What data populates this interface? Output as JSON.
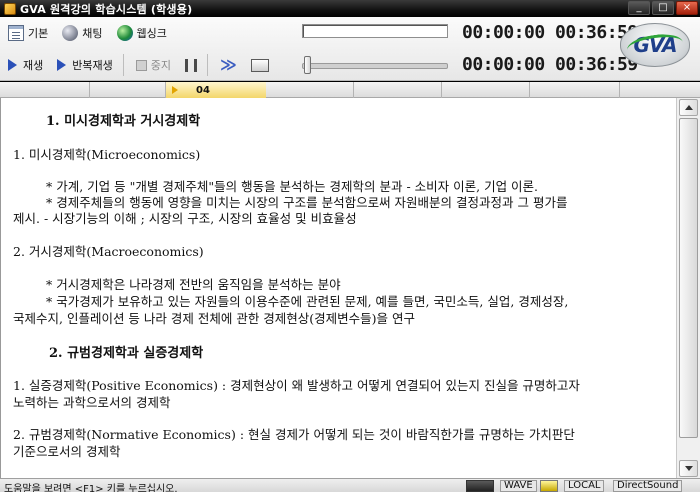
{
  "window": {
    "title": "GVA 원격강의 학습시스템 (학생용)",
    "buttons": {
      "minimize": "_",
      "maximize": "□",
      "close": "×"
    }
  },
  "toolbar": {
    "basic_label": "기본",
    "chat_label": "채팅",
    "weblink_label": "웹싱크",
    "play_label": "재생",
    "repeat_label": "반복재생",
    "stop_label": "중지",
    "fastforward_glyph": "≫"
  },
  "player": {
    "time_top": "00:00:00 00:36:59",
    "time_bottom": "00:00:00 00:36:59",
    "slider_position": 0.0
  },
  "logo": {
    "text": "GVA"
  },
  "chapter": {
    "current": "04"
  },
  "content": {
    "lines": [
      "1. 미시경제학과 거시경제학",
      "1.  미시경제학(Microeconomics)",
      "* 가계, 기업 등 \"개별 경제주체\"들의 행동을 분석하는 경제학의 분과 - 소비자 이론, 기업 이론.",
      "* 경제주체들의 행동에 영향을 미치는 시장의 구조를 분석함으로써 자원배분의 결정과정과 그 평가를",
      "제시. - 시장기능의 이해 ; 시장의 구조, 시장의 효율성 및 비효율성",
      "2.  거시경제학(Macroeconomics)",
      "* 거시경제학은 나라경제 전반의 움직임을 분석하는 분야",
      "* 국가경제가 보유하고 있는 자원들의 이용수준에 관련된 문제, 예를 들면, 국민소득, 실업, 경제성장,",
      "국제수지, 인플레이션 등 나라 경제 전체에 관한 경제현상(경제변수들)을 연구",
      "2. 규범경제학과 실증경제학",
      "1.  실증경제학(Positive Economics) : 경제현상이 왜 발생하고 어떻게 연결되어 있는지 진실을 규명하고자",
      "노력하는 과학으로서의 경제학",
      "2.  규범경제학(Normative Economics) :  현실 경제가 어떻게 되는 것이 바람직한가를 규명하는 가치판단",
      "기준으로서의 경제학"
    ]
  },
  "statusbar": {
    "help": "도움말을 보려면 <F1> 키를 누르십시오.",
    "wave": "WAVE",
    "local": "LOCAL",
    "sound": "DirectSound"
  }
}
